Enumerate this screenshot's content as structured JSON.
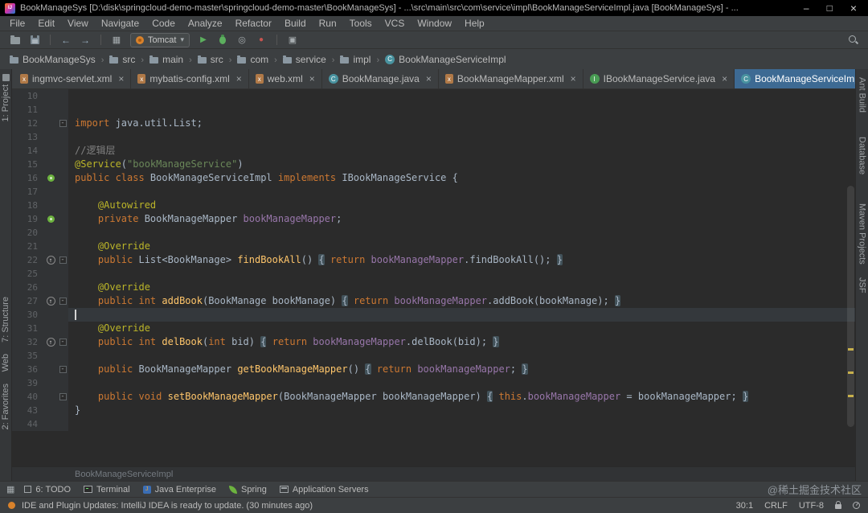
{
  "window": {
    "title": "BookManageSys [D:\\disk\\springcloud-demo-master\\springcloud-demo-master\\BookManageSys] - ...\\src\\main\\src\\com\\service\\impl\\BookManageServiceImpl.java [BookManageSys] - ..."
  },
  "menubar": {
    "items": [
      "File",
      "Edit",
      "View",
      "Navigate",
      "Code",
      "Analyze",
      "Refactor",
      "Build",
      "Run",
      "Tools",
      "VCS",
      "Window",
      "Help"
    ]
  },
  "toolbar": {
    "items": [
      {
        "kind": "button",
        "name": "open-button",
        "icon": "folder"
      },
      {
        "kind": "button",
        "name": "save-all-button",
        "icon": "floppy"
      },
      {
        "kind": "sep"
      },
      {
        "kind": "button",
        "name": "back-button",
        "icon": "arrow-left"
      },
      {
        "kind": "button",
        "name": "forward-button",
        "icon": "arrow-right"
      },
      {
        "kind": "sep"
      },
      {
        "kind": "button",
        "name": "build-button",
        "icon": "grid"
      },
      {
        "kind": "runconfig",
        "name": "run-config-selector",
        "icon": "tomcat",
        "label": "Tomcat"
      },
      {
        "kind": "button",
        "name": "run-button",
        "icon": "play"
      },
      {
        "kind": "button",
        "name": "debug-button",
        "icon": "bug"
      },
      {
        "kind": "button",
        "name": "coverage-button",
        "icon": "coverage"
      },
      {
        "kind": "button",
        "name": "stop-button",
        "icon": "stop"
      },
      {
        "kind": "sep"
      },
      {
        "kind": "button",
        "name": "app-servers-button",
        "icon": "monitor"
      }
    ]
  },
  "navbar": {
    "items": [
      {
        "label": "BookManageSys",
        "icon": "folder"
      },
      {
        "label": "src",
        "icon": "folder"
      },
      {
        "label": "main",
        "icon": "folder"
      },
      {
        "label": "src",
        "icon": "folder"
      },
      {
        "label": "com",
        "icon": "folder"
      },
      {
        "label": "service",
        "icon": "folder"
      },
      {
        "label": "impl",
        "icon": "folder"
      },
      {
        "label": "BookManageServiceImpl",
        "icon": "class"
      }
    ]
  },
  "tabbar": {
    "hidden_count": "4",
    "tabs": [
      {
        "label": "ingmvc-servlet.xml",
        "icon": "xml-file-icon"
      },
      {
        "label": "mybatis-config.xml",
        "icon": "xml-file-icon"
      },
      {
        "label": "web.xml",
        "icon": "xml-file-icon"
      },
      {
        "label": "BookManage.java",
        "icon": "java-class-icon"
      },
      {
        "label": "BookManageMapper.xml",
        "icon": "xml-file-icon"
      },
      {
        "label": "IBookManageService.java",
        "icon": "java-interface-icon"
      },
      {
        "label": "BookManageServiceImpl.java",
        "icon": "java-class-icon",
        "active": true
      }
    ]
  },
  "left_strip": {
    "items": [
      {
        "label": "1: Project"
      },
      {
        "label": "7: Structure"
      },
      {
        "label": "Web"
      },
      {
        "label": "2: Favorites"
      }
    ]
  },
  "right_strip": {
    "items": [
      {
        "label": "Ant Build"
      },
      {
        "label": "Database"
      },
      {
        "label": "Maven Projects"
      },
      {
        "label": "JSF"
      }
    ]
  },
  "editor": {
    "breadcrumb": "BookManageServiceImpl",
    "caret_line": "30",
    "lines": [
      {
        "n": "10",
        "tokens": []
      },
      {
        "n": "11",
        "tokens": []
      },
      {
        "n": "12",
        "fold": true,
        "tokens": [
          {
            "t": "import ",
            "c": "kw"
          },
          {
            "t": "java.util.List;",
            "c": "def"
          }
        ]
      },
      {
        "n": "13",
        "tokens": []
      },
      {
        "n": "14",
        "tokens": [
          {
            "t": "//逻辑层",
            "c": "com"
          }
        ]
      },
      {
        "n": "15",
        "tokens": [
          {
            "t": "@Service",
            "c": "ann"
          },
          {
            "t": "(",
            "c": "def"
          },
          {
            "t": "\"bookManageService\"",
            "c": "str"
          },
          {
            "t": ")",
            "c": "def"
          }
        ]
      },
      {
        "n": "16",
        "icon": "spring",
        "tokens": [
          {
            "t": "public class ",
            "c": "kw"
          },
          {
            "t": "BookManageServiceImpl ",
            "c": "def"
          },
          {
            "t": "implements ",
            "c": "kw"
          },
          {
            "t": "IBookManageService {",
            "c": "def"
          }
        ]
      },
      {
        "n": "17",
        "tokens": []
      },
      {
        "n": "18",
        "tokens": [
          {
            "t": "    ",
            "c": "def"
          },
          {
            "t": "@Autowired",
            "c": "ann"
          }
        ]
      },
      {
        "n": "19",
        "icon": "spring",
        "tokens": [
          {
            "t": "    ",
            "c": "def"
          },
          {
            "t": "private ",
            "c": "kw"
          },
          {
            "t": "BookManageMapper ",
            "c": "def"
          },
          {
            "t": "bookManageMapper",
            "c": "field"
          },
          {
            "t": ";",
            "c": "def"
          }
        ]
      },
      {
        "n": "20",
        "tokens": []
      },
      {
        "n": "21",
        "tokens": [
          {
            "t": "    ",
            "c": "def"
          },
          {
            "t": "@Override",
            "c": "ann"
          }
        ]
      },
      {
        "n": "22",
        "icon": "override",
        "fold": true,
        "tokens": [
          {
            "t": "    ",
            "c": "def"
          },
          {
            "t": "public ",
            "c": "kw"
          },
          {
            "t": "List<BookManage> ",
            "c": "def"
          },
          {
            "t": "findBookAll",
            "c": "mth"
          },
          {
            "t": "() ",
            "c": "def"
          },
          {
            "t": "{",
            "c": "foldseg"
          },
          {
            "t": " ",
            "c": "def"
          },
          {
            "t": "return ",
            "c": "kw"
          },
          {
            "t": "bookManageMapper",
            "c": "field"
          },
          {
            "t": ".findBookAll()",
            "c": "def"
          },
          {
            "t": ";",
            "c": "def"
          },
          {
            "t": " ",
            "c": "def"
          },
          {
            "t": "}",
            "c": "foldseg"
          }
        ]
      },
      {
        "n": "25",
        "tokens": []
      },
      {
        "n": "26",
        "tokens": [
          {
            "t": "    ",
            "c": "def"
          },
          {
            "t": "@Override",
            "c": "ann"
          }
        ]
      },
      {
        "n": "27",
        "icon": "override",
        "fold": true,
        "tokens": [
          {
            "t": "    ",
            "c": "def"
          },
          {
            "t": "public int ",
            "c": "kw"
          },
          {
            "t": "addBook",
            "c": "mth"
          },
          {
            "t": "(",
            "c": "def"
          },
          {
            "t": "BookManage bookManage",
            "c": "def"
          },
          {
            "t": ") ",
            "c": "def"
          },
          {
            "t": "{",
            "c": "foldseg"
          },
          {
            "t": " ",
            "c": "def"
          },
          {
            "t": "return ",
            "c": "kw"
          },
          {
            "t": "bookManageMapper",
            "c": "field"
          },
          {
            "t": ".addBook(bookManage)",
            "c": "def"
          },
          {
            "t": ";",
            "c": "def"
          },
          {
            "t": " ",
            "c": "def"
          },
          {
            "t": "}",
            "c": "foldseg"
          }
        ]
      },
      {
        "n": "30",
        "current": true,
        "tokens": []
      },
      {
        "n": "31",
        "tokens": [
          {
            "t": "    ",
            "c": "def"
          },
          {
            "t": "@Override",
            "c": "ann"
          }
        ]
      },
      {
        "n": "32",
        "icon": "override",
        "fold": true,
        "tokens": [
          {
            "t": "    ",
            "c": "def"
          },
          {
            "t": "public int ",
            "c": "kw"
          },
          {
            "t": "delBook",
            "c": "mth"
          },
          {
            "t": "(",
            "c": "def"
          },
          {
            "t": "int ",
            "c": "kw"
          },
          {
            "t": "bid",
            "c": "def"
          },
          {
            "t": ") ",
            "c": "def"
          },
          {
            "t": "{",
            "c": "foldseg"
          },
          {
            "t": " ",
            "c": "def"
          },
          {
            "t": "return ",
            "c": "kw"
          },
          {
            "t": "bookManageMapper",
            "c": "field"
          },
          {
            "t": ".delBook(bid)",
            "c": "def"
          },
          {
            "t": ";",
            "c": "def"
          },
          {
            "t": " ",
            "c": "def"
          },
          {
            "t": "}",
            "c": "foldseg"
          }
        ]
      },
      {
        "n": "35",
        "tokens": []
      },
      {
        "n": "36",
        "fold": true,
        "tokens": [
          {
            "t": "    ",
            "c": "def"
          },
          {
            "t": "public ",
            "c": "kw"
          },
          {
            "t": "BookManageMapper ",
            "c": "def"
          },
          {
            "t": "getBookManageMapper",
            "c": "mth"
          },
          {
            "t": "() ",
            "c": "def"
          },
          {
            "t": "{",
            "c": "foldseg"
          },
          {
            "t": " ",
            "c": "def"
          },
          {
            "t": "return ",
            "c": "kw"
          },
          {
            "t": "bookManageMapper",
            "c": "field"
          },
          {
            "t": ";",
            "c": "def"
          },
          {
            "t": " ",
            "c": "def"
          },
          {
            "t": "}",
            "c": "foldseg"
          }
        ]
      },
      {
        "n": "39",
        "tokens": []
      },
      {
        "n": "40",
        "fold": true,
        "tokens": [
          {
            "t": "    ",
            "c": "def"
          },
          {
            "t": "public void ",
            "c": "kw"
          },
          {
            "t": "setBookManageMapper",
            "c": "mth"
          },
          {
            "t": "(",
            "c": "def"
          },
          {
            "t": "BookManageMapper bookManageMapper",
            "c": "def"
          },
          {
            "t": ") ",
            "c": "def"
          },
          {
            "t": "{",
            "c": "foldseg"
          },
          {
            "t": " ",
            "c": "def"
          },
          {
            "t": "this",
            "c": "kw"
          },
          {
            "t": ".",
            "c": "def"
          },
          {
            "t": "bookManageMapper",
            "c": "field"
          },
          {
            "t": " = ",
            "c": "def"
          },
          {
            "t": "bookManageMapper",
            "c": "def"
          },
          {
            "t": ";",
            "c": "def"
          },
          {
            "t": " ",
            "c": "def"
          },
          {
            "t": "}",
            "c": "foldseg"
          }
        ]
      },
      {
        "n": "43",
        "tokens": [
          {
            "t": "}",
            "c": "def"
          }
        ]
      },
      {
        "n": "44",
        "tokens": []
      }
    ]
  },
  "bottombar": {
    "items": [
      {
        "label": "6: TODO",
        "icon": "todo"
      },
      {
        "label": "Terminal",
        "icon": "terminal"
      },
      {
        "label": "Java Enterprise",
        "icon": "javaee"
      },
      {
        "label": "Spring",
        "icon": "spring"
      },
      {
        "label": "Application Servers",
        "icon": "appserver"
      }
    ],
    "watermark": "@稀土掘金技术社区"
  },
  "statusbar": {
    "message": "IDE and Plugin Updates: IntelliJ IDEA is ready to update. (30 minutes ago)",
    "items": [
      {
        "label": "30:1",
        "name": "caret-position"
      },
      {
        "label": "CRLF",
        "name": "line-separator"
      },
      {
        "label": "UTF-8",
        "name": "file-encoding"
      }
    ]
  },
  "colors": {
    "title_bar": "#000000",
    "panel_background": "#3c3f41",
    "editor_background": "#2b2b2b",
    "active_tab": "#3d6a93",
    "keyword": "#cc7832",
    "string": "#6a8759",
    "annotation": "#bbb529",
    "comment": "#808080",
    "field": "#9876aa",
    "method_declaration": "#ffc66b",
    "default_text": "#a9b7c6",
    "line_number": "#606366",
    "error_stripe_warning": "#c7b04c",
    "spring_green": "#6db33f"
  }
}
